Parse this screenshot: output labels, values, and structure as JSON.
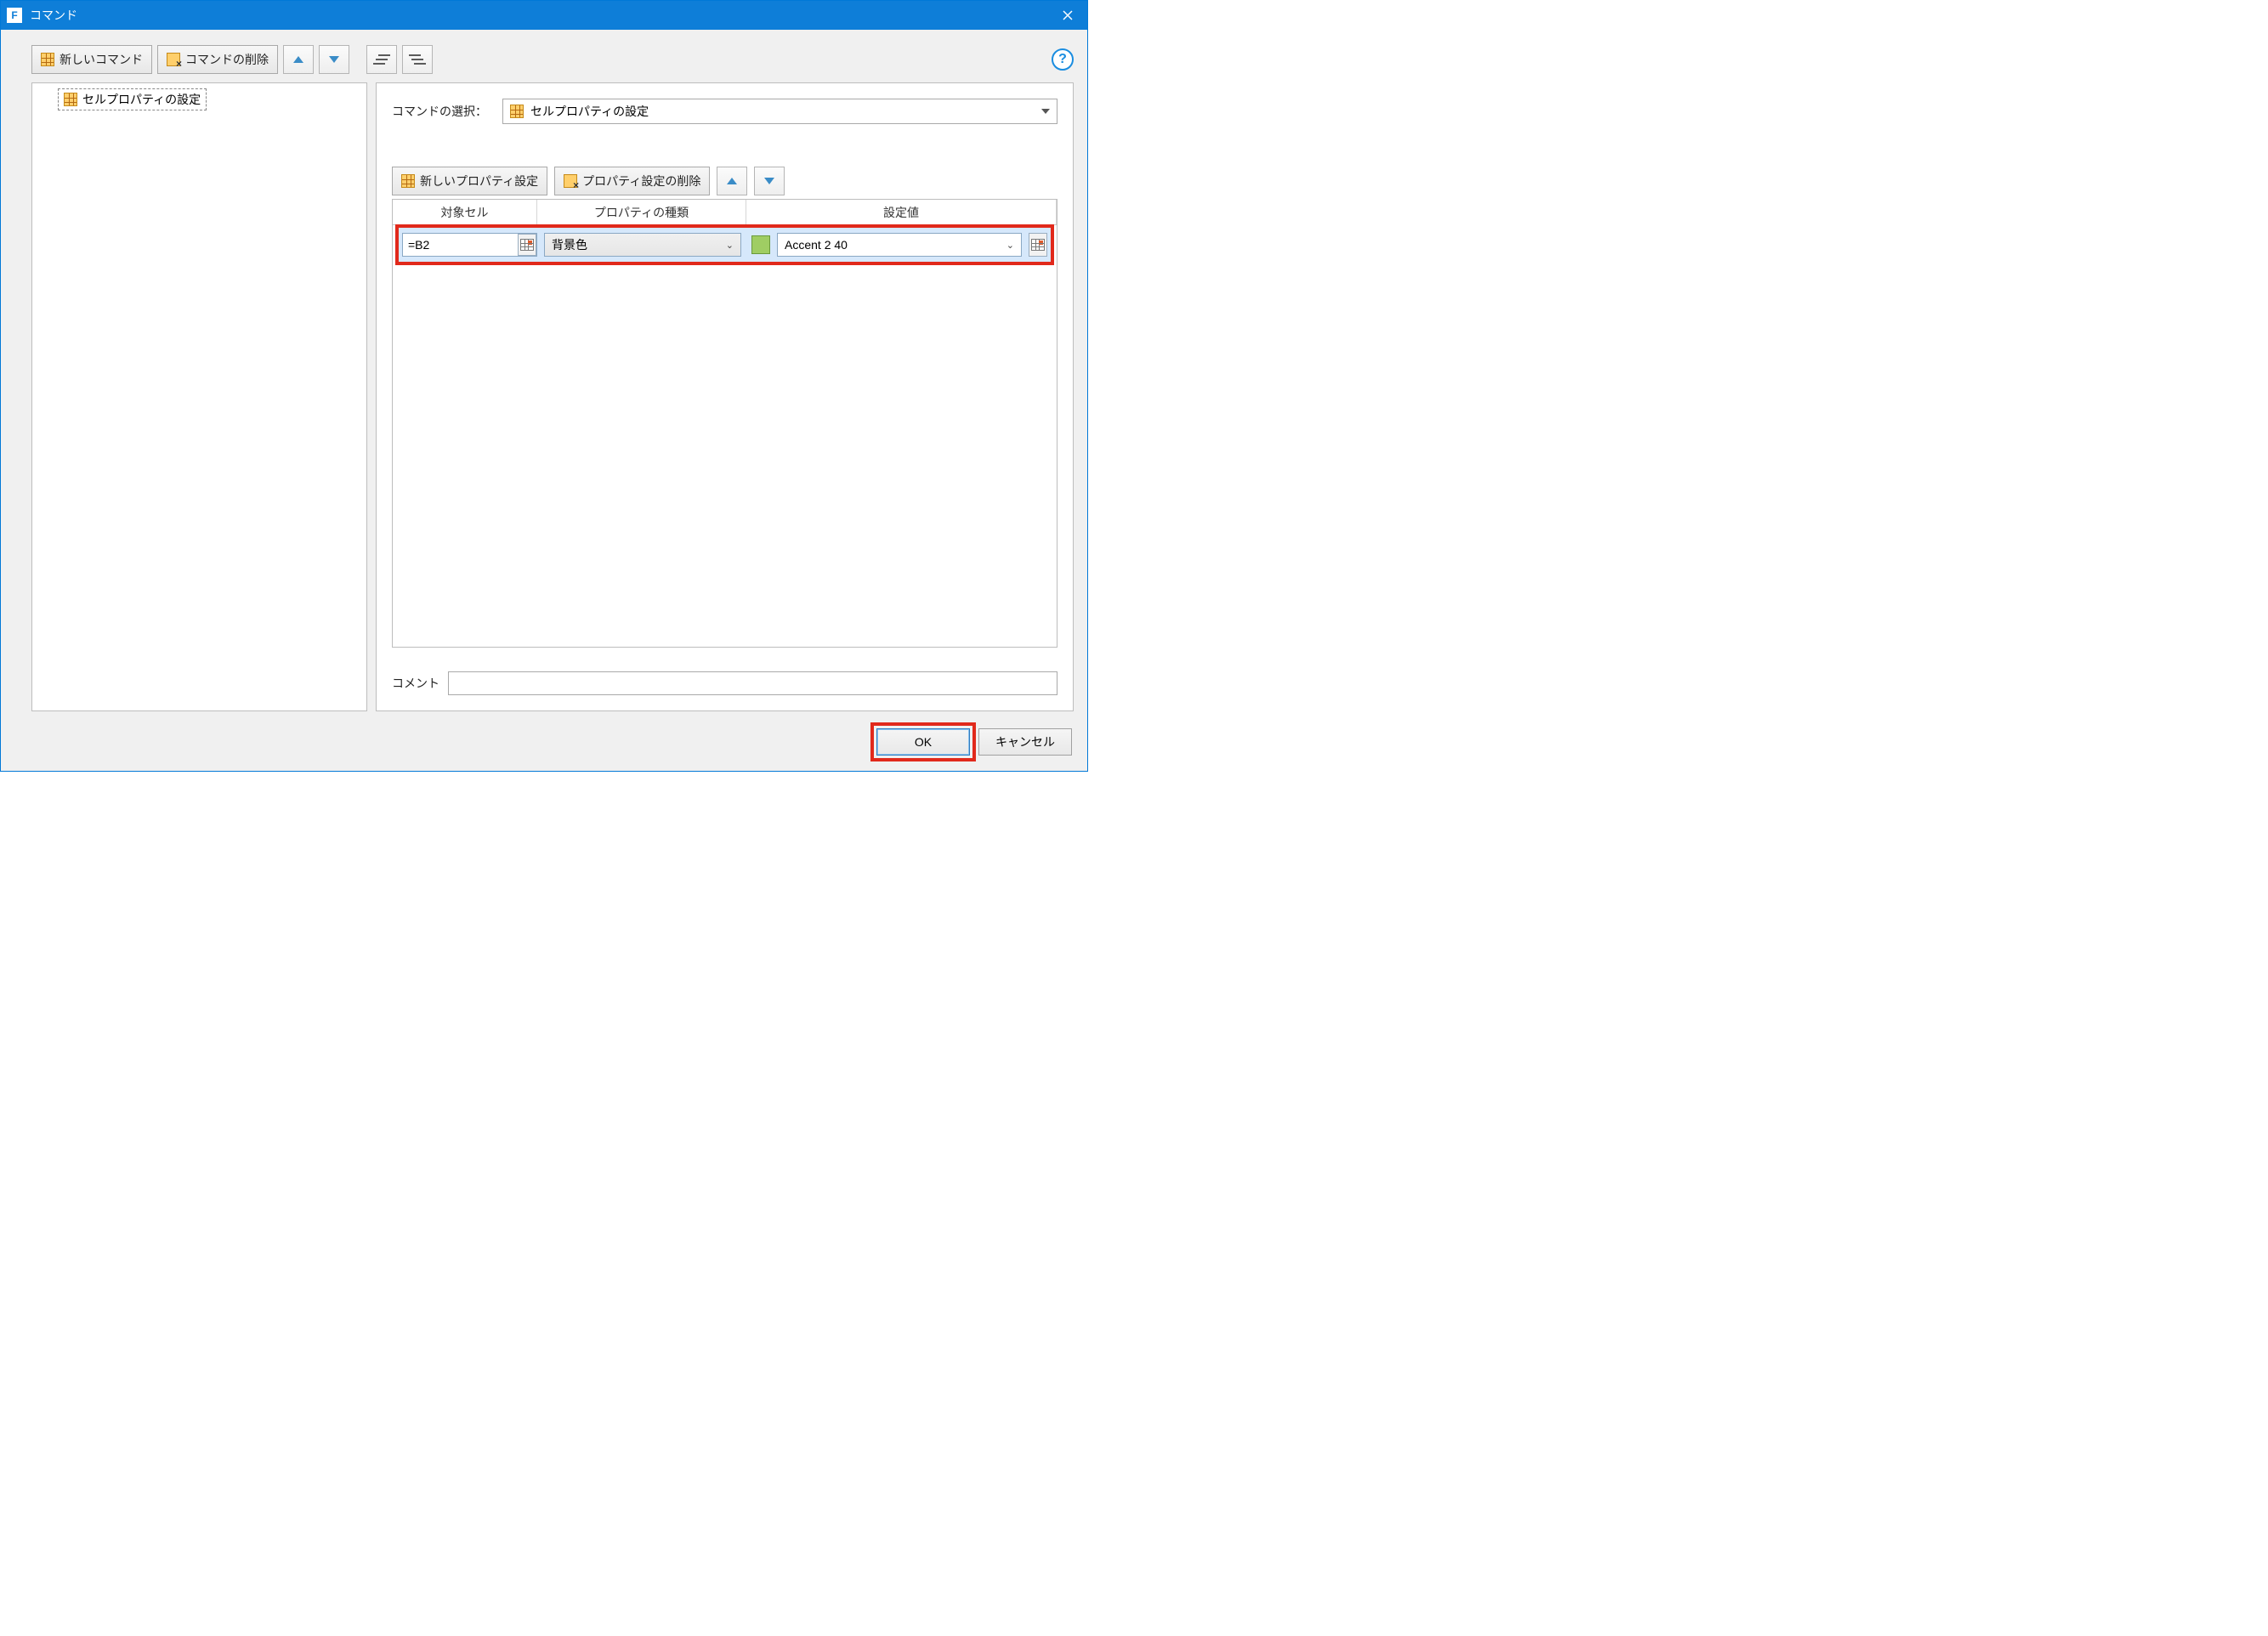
{
  "window": {
    "title": "コマンド"
  },
  "toolbar": {
    "new_command": "新しいコマンド",
    "delete_command": "コマンドの削除",
    "help_tooltip": "?"
  },
  "tree": {
    "items": [
      {
        "label": "セルプロパティの設定"
      }
    ]
  },
  "detail": {
    "command_select_label": "コマンドの選択：",
    "command_select_value": "セルプロパティの設定",
    "new_property": "新しいプロパティ設定",
    "delete_property": "プロパティ設定の削除",
    "columns": {
      "target": "対象セル",
      "type": "プロパティの種類",
      "value": "設定値"
    },
    "rows": [
      {
        "target": "=B2",
        "type": "背景色",
        "swatch_color": "#9fcd63",
        "value": "Accent 2 40"
      }
    ],
    "comment_label": "コメント",
    "comment_value": ""
  },
  "footer": {
    "ok": "OK",
    "cancel": "キャンセル"
  }
}
